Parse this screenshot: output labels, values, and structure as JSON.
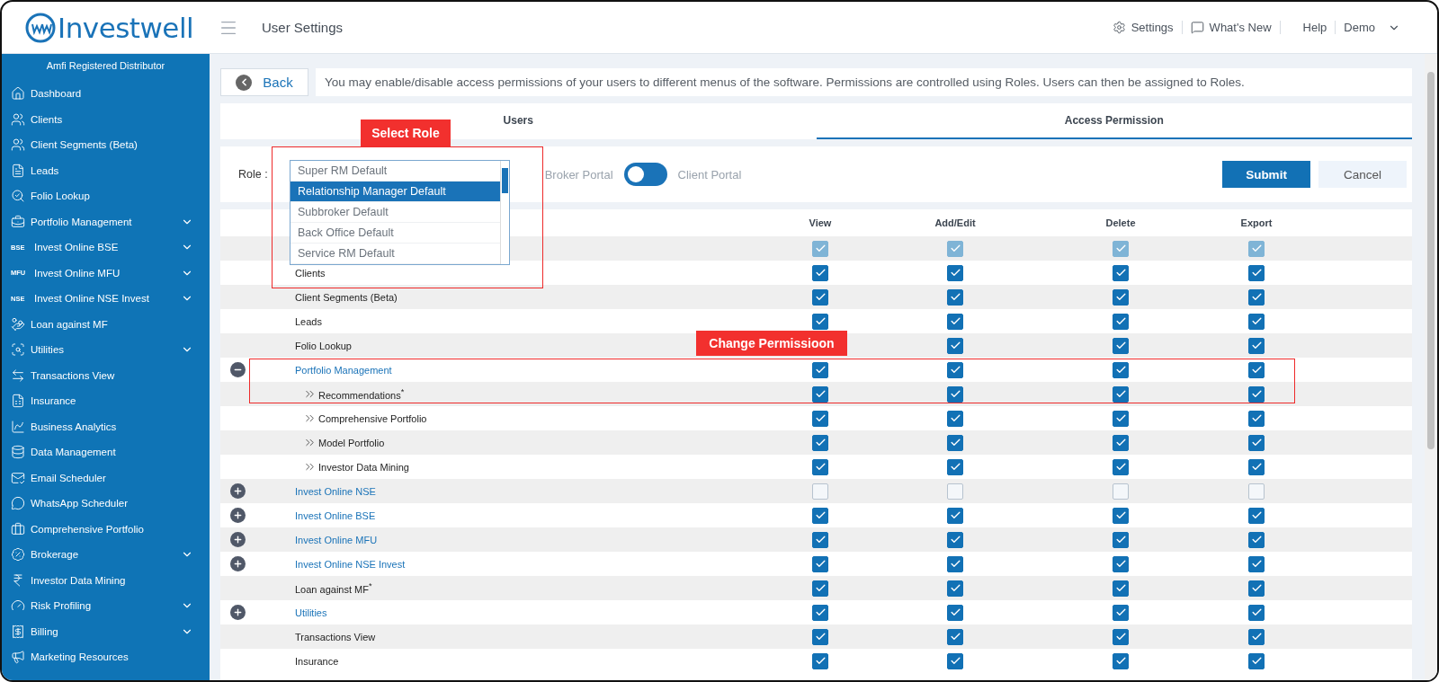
{
  "header": {
    "logo": "Investwell",
    "title": "User Settings",
    "links": [
      {
        "label": "Settings"
      },
      {
        "label": "What's New"
      },
      {
        "label": "Help"
      }
    ],
    "user": "Demo"
  },
  "sidebar": {
    "heading": "Amfi Registered Distributor",
    "items": [
      {
        "label": "Dashboard",
        "expandable": false
      },
      {
        "label": "Clients",
        "expandable": false
      },
      {
        "label": "Client Segments (Beta)",
        "expandable": false
      },
      {
        "label": "Leads",
        "expandable": false
      },
      {
        "label": "Folio Lookup",
        "expandable": false
      },
      {
        "label": "Portfolio Management",
        "expandable": true
      },
      {
        "label": "Invest Online BSE",
        "badge": "BSE",
        "expandable": true
      },
      {
        "label": "Invest Online MFU",
        "badge": "MFU",
        "expandable": true
      },
      {
        "label": "Invest Online NSE Invest",
        "badge": "NSE",
        "expandable": true
      },
      {
        "label": "Loan against MF",
        "expandable": false
      },
      {
        "label": "Utilities",
        "expandable": true
      },
      {
        "label": "Transactions View",
        "expandable": false
      },
      {
        "label": "Insurance",
        "expandable": false
      },
      {
        "label": "Business Analytics",
        "expandable": false
      },
      {
        "label": "Data Management",
        "expandable": false
      },
      {
        "label": "Email Scheduler",
        "expandable": false
      },
      {
        "label": "WhatsApp Scheduler",
        "expandable": false
      },
      {
        "label": "Comprehensive Portfolio",
        "expandable": false
      },
      {
        "label": "Brokerage",
        "expandable": true
      },
      {
        "label": "Investor Data Mining",
        "expandable": false
      },
      {
        "label": "Risk Profiling",
        "expandable": true
      },
      {
        "label": "Billing",
        "expandable": true
      },
      {
        "label": "Marketing Resources",
        "expandable": false
      }
    ]
  },
  "back_button": "Back",
  "info": "You may enable/disable access permissions of your users to different menus of the software. Permissions are controlled using Roles. Users can then be assigned to Roles.",
  "tabs": [
    {
      "label": "Users",
      "selected": false
    },
    {
      "label": "Access Permission",
      "selected": true
    }
  ],
  "role": {
    "label": "Role :",
    "options": [
      {
        "label": "Super RM Default",
        "selected": false
      },
      {
        "label": "Relationship Manager Default",
        "selected": true
      },
      {
        "label": "Subbroker Default",
        "selected": false
      },
      {
        "label": "Back Office Default",
        "selected": false
      },
      {
        "label": "Service RM Default",
        "selected": false
      }
    ]
  },
  "portal_toggle": {
    "left_label": "Broker Portal",
    "right_label": "Client Portal",
    "client_portal_selected": false
  },
  "buttons": {
    "submit": "Submit",
    "cancel": "Cancel"
  },
  "table": {
    "columns": [
      "View",
      "Add/Edit",
      "Delete",
      "Export"
    ],
    "rows": [
      {
        "perms": {
          "view": {
            "checked": true,
            "disabled": true
          },
          "add_edit": {
            "checked": true,
            "disabled": true
          },
          "delete": {
            "checked": true,
            "disabled": true
          },
          "export": {
            "checked": true,
            "disabled": true
          }
        }
      },
      {
        "label": "Clients",
        "perms": {
          "view": {
            "checked": true,
            "disabled": false
          },
          "add_edit": {
            "checked": true,
            "disabled": false
          },
          "delete": {
            "checked": true,
            "disabled": false
          },
          "export": {
            "checked": true,
            "disabled": false
          }
        }
      },
      {
        "label": "Client Segments (Beta)",
        "perms": {
          "view": {
            "checked": true,
            "disabled": false
          },
          "add_edit": {
            "checked": true,
            "disabled": false
          },
          "delete": {
            "checked": true,
            "disabled": false
          },
          "export": {
            "checked": true,
            "disabled": false
          }
        }
      },
      {
        "label": "Leads",
        "perms": {
          "view": {
            "checked": true,
            "disabled": false
          },
          "add_edit": {
            "checked": true,
            "disabled": false
          },
          "delete": {
            "checked": true,
            "disabled": false
          },
          "export": {
            "checked": true,
            "disabled": false
          }
        }
      },
      {
        "label": "Folio Lookup",
        "perms": {
          "add_edit": {
            "checked": true,
            "disabled": false
          },
          "delete": {
            "checked": true,
            "disabled": false
          },
          "export": {
            "checked": true,
            "disabled": false
          }
        }
      },
      {
        "label": "Portfolio Management",
        "expandable": true,
        "expanded": true,
        "perms": {
          "view": {
            "checked": true,
            "disabled": false
          },
          "add_edit": {
            "checked": true,
            "disabled": false
          },
          "delete": {
            "checked": true,
            "disabled": false
          },
          "export": {
            "checked": true,
            "disabled": false
          }
        },
        "children": [
          {
            "label": "Recommendations$^{*}$",
            "perms": {
              "view": {
                "checked": true,
                "disabled": false
              },
              "add_edit": {
                "checked": true,
                "disabled": false
              },
              "delete": {
                "checked": true,
                "disabled": false
              },
              "export": {
                "checked": true,
                "disabled": false
              }
            }
          },
          {
            "label": "Comprehensive Portfolio",
            "perms": {
              "view": {
                "checked": true,
                "disabled": false
              },
              "add_edit": {
                "checked": true,
                "disabled": false
              },
              "delete": {
                "checked": true,
                "disabled": false
              },
              "export": {
                "checked": true,
                "disabled": false
              }
            }
          },
          {
            "label": "Model Portfolio",
            "perms": {
              "view": {
                "checked": true,
                "disabled": false
              },
              "add_edit": {
                "checked": true,
                "disabled": false
              },
              "delete": {
                "checked": true,
                "disabled": false
              },
              "export": {
                "checked": true,
                "disabled": false
              }
            }
          },
          {
            "label": "Investor Data Mining",
            "perms": {
              "view": {
                "checked": true,
                "disabled": false
              },
              "add_edit": {
                "checked": true,
                "disabled": false
              },
              "delete": {
                "checked": true,
                "disabled": false
              },
              "export": {
                "checked": true,
                "disabled": false
              }
            }
          }
        ]
      },
      {
        "label": "Invest Online NSE",
        "expandable": true,
        "expanded": false,
        "perms": {
          "view": {
            "checked": false,
            "disabled": false
          },
          "add_edit": {
            "checked": false,
            "disabled": false
          },
          "delete": {
            "checked": false,
            "disabled": false
          },
          "export": {
            "checked": false,
            "disabled": false
          }
        }
      },
      {
        "label": "Invest Online BSE",
        "expandable": true,
        "expanded": false,
        "perms": {
          "view": {
            "checked": true,
            "disabled": false
          },
          "add_edit": {
            "checked": true,
            "disabled": false
          },
          "delete": {
            "checked": true,
            "disabled": false
          },
          "export": {
            "checked": true,
            "disabled": false
          }
        }
      },
      {
        "label": "Invest Online MFU",
        "expandable": true,
        "expanded": false,
        "perms": {
          "view": {
            "checked": true,
            "disabled": false
          },
          "add_edit": {
            "checked": true,
            "disabled": false
          },
          "delete": {
            "checked": true,
            "disabled": false
          },
          "export": {
            "checked": true,
            "disabled": false
          }
        }
      },
      {
        "label": "Invest Online NSE Invest",
        "expandable": true,
        "expanded": false,
        "perms": {
          "view": {
            "checked": true,
            "disabled": false
          },
          "add_edit": {
            "checked": true,
            "disabled": false
          },
          "delete": {
            "checked": true,
            "disabled": false
          },
          "export": {
            "checked": true,
            "disabled": false
          }
        }
      },
      {
        "label": "Loan against MF$^{*}$",
        "perms": {
          "view": {
            "checked": true,
            "disabled": false
          },
          "add_edit": {
            "checked": true,
            "disabled": false
          },
          "delete": {
            "checked": true,
            "disabled": false
          },
          "export": {
            "checked": true,
            "disabled": false
          }
        }
      },
      {
        "label": "Utilities",
        "expandable": true,
        "expanded": false,
        "perms": {
          "view": {
            "checked": true,
            "disabled": false
          },
          "add_edit": {
            "checked": true,
            "disabled": false
          },
          "delete": {
            "checked": true,
            "disabled": false
          },
          "export": {
            "checked": true,
            "disabled": false
          }
        }
      },
      {
        "label": "Transactions View",
        "perms": {
          "view": {
            "checked": true,
            "disabled": false
          },
          "add_edit": {
            "checked": true,
            "disabled": false
          },
          "delete": {
            "checked": true,
            "disabled": false
          },
          "export": {
            "checked": true,
            "disabled": false
          }
        }
      },
      {
        "label": "Insurance",
        "perms": {
          "view": {
            "checked": true,
            "disabled": false
          },
          "add_edit": {
            "checked": true,
            "disabled": false
          },
          "delete": {
            "checked": true,
            "disabled": false
          },
          "export": {
            "checked": true,
            "disabled": false
          }
        }
      }
    ]
  },
  "annotations": [
    {
      "label": "Select Role"
    },
    {
      "label": "Change Permissioon"
    }
  ]
}
